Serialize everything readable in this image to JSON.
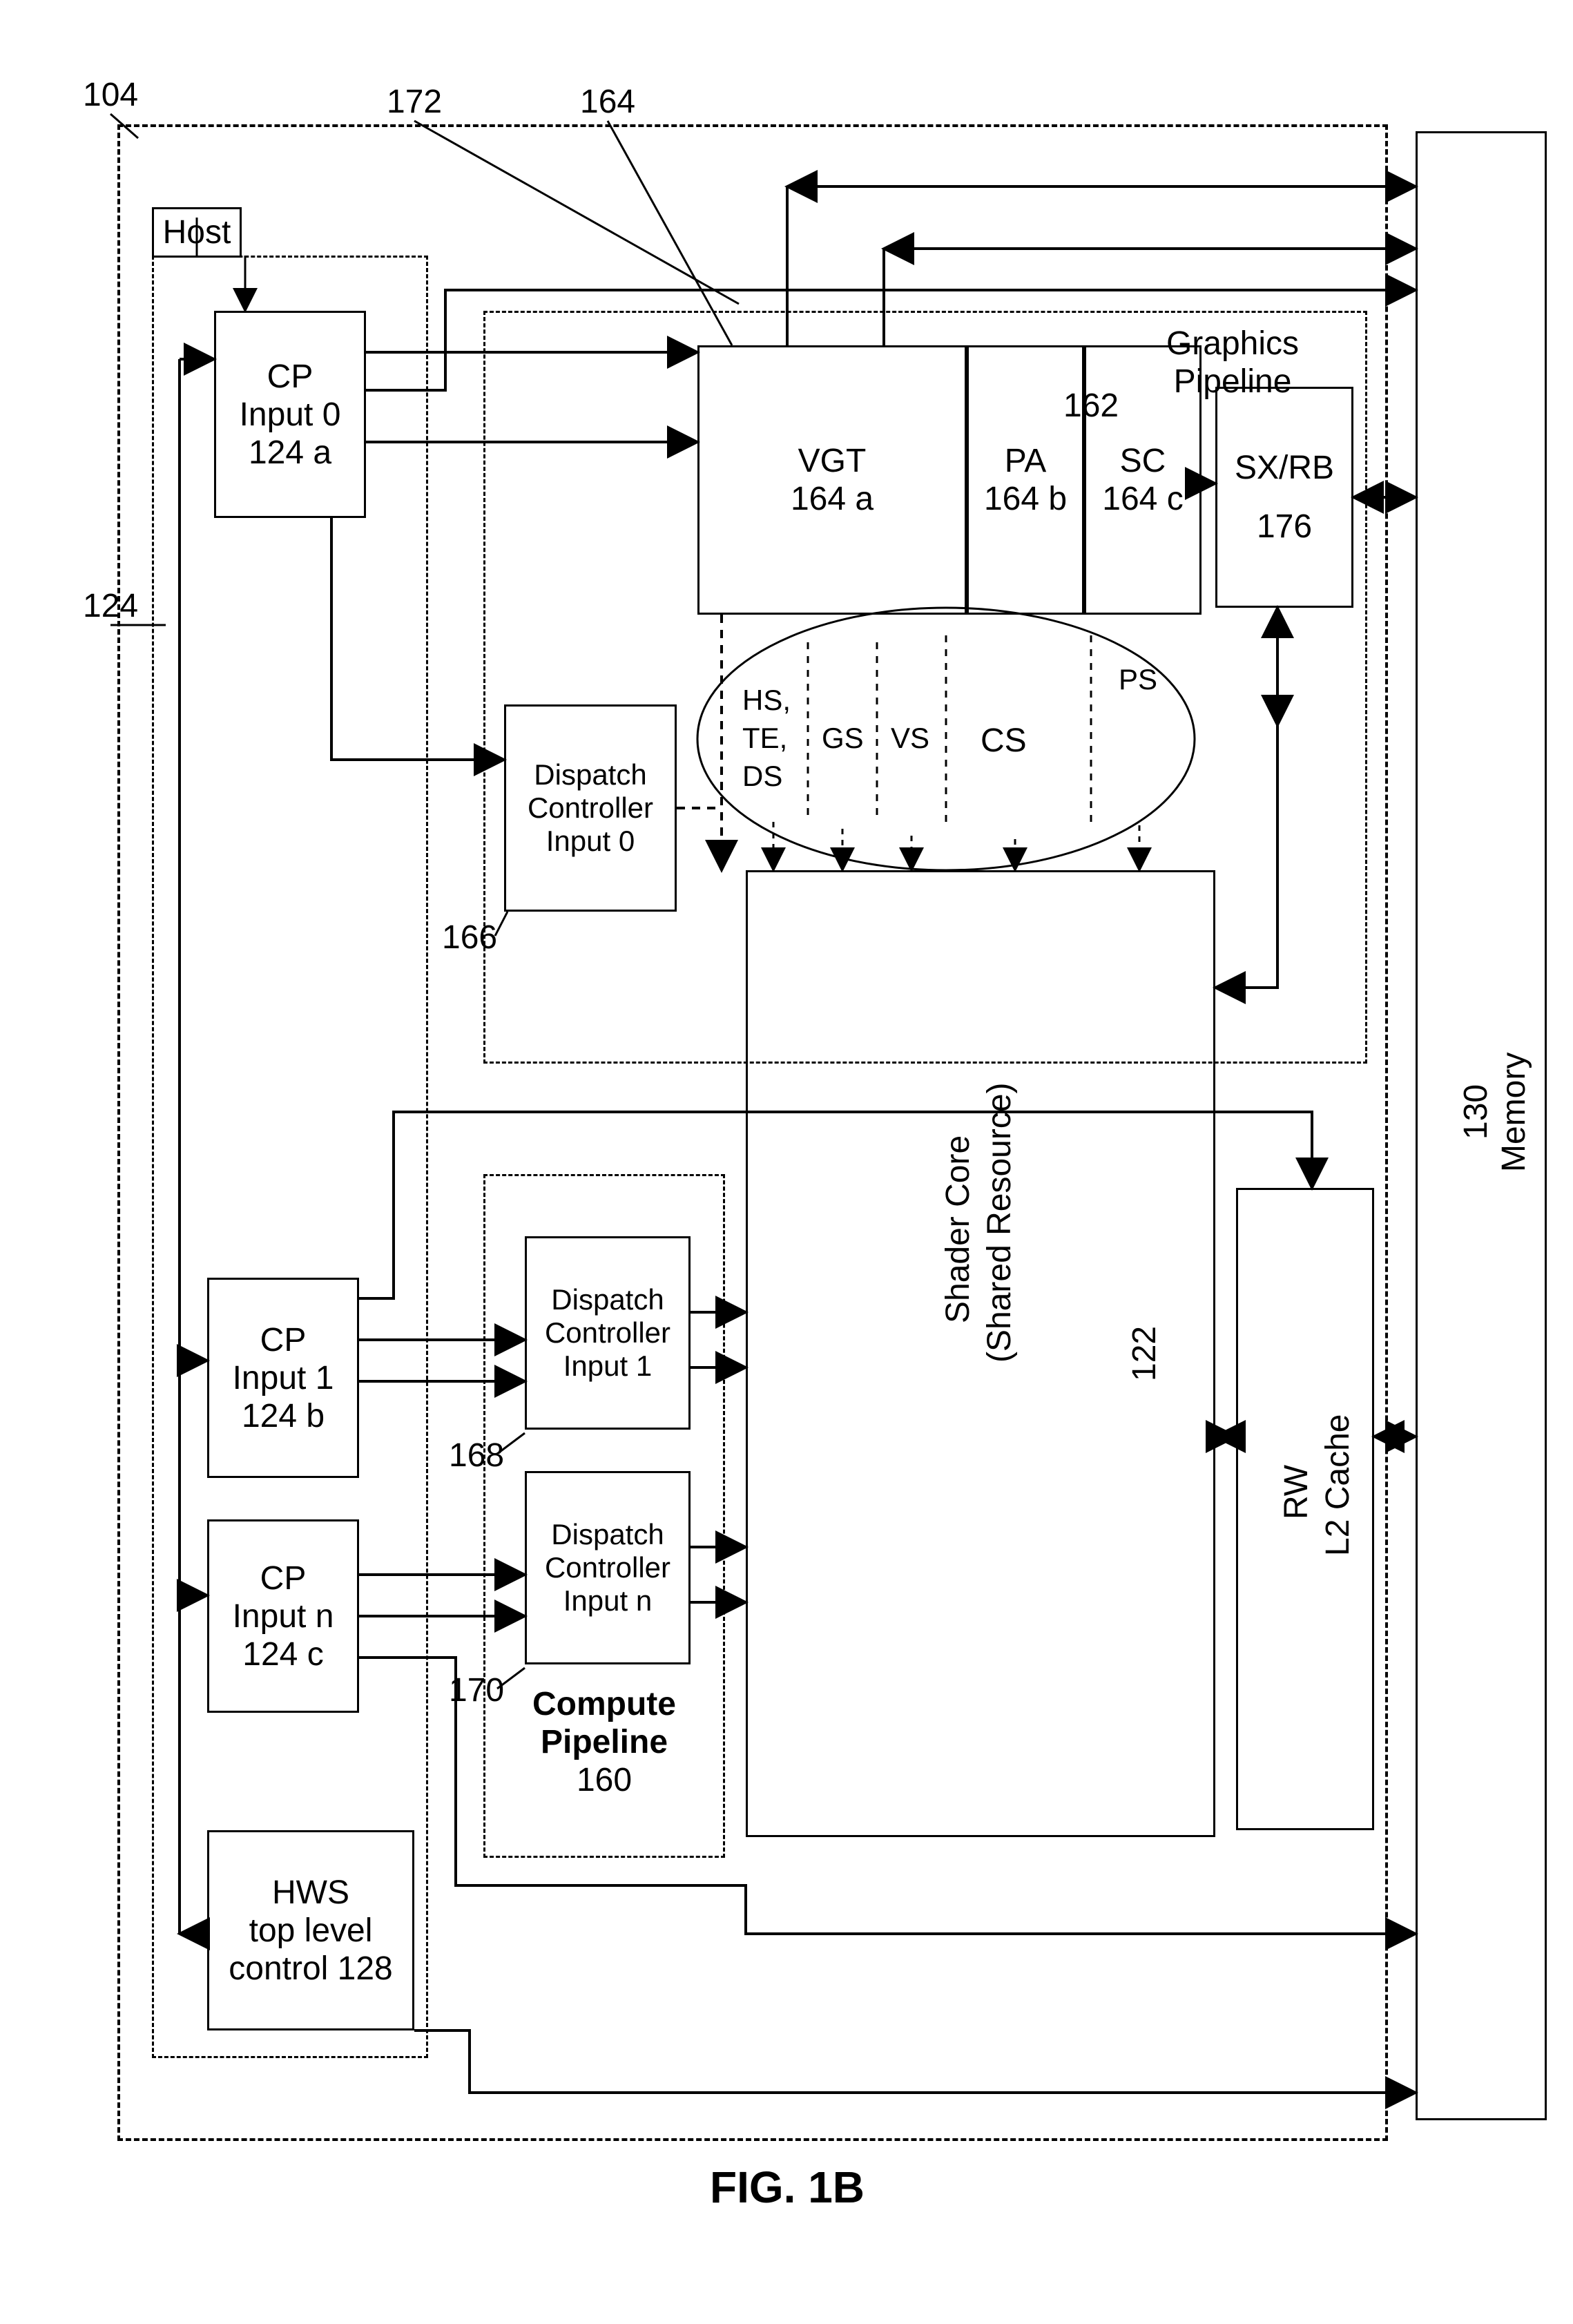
{
  "figure": "FIG. 1B",
  "refs": {
    "chip": "104",
    "cp_group": "124",
    "hws": "128",
    "memory": "130",
    "shader": "122",
    "compute_pipeline": "160",
    "graphics_pipeline": "162",
    "asm_group": "164",
    "vgt": "164 a",
    "pa": "164 b",
    "sc": "164 c",
    "dc0": "166",
    "dc1": "168",
    "dcn": "170",
    "arrow_vgt_mem": "172",
    "sxrb": "176"
  },
  "blocks": {
    "host": "Host",
    "cp0": {
      "l1": "CP",
      "l2": "Input 0",
      "ref": "124 a"
    },
    "cp1": {
      "l1": "CP",
      "l2": "Input 1",
      "ref": "124 b"
    },
    "cpn": {
      "l1": "CP",
      "l2": "Input n",
      "ref": "124 c"
    },
    "hws": {
      "l1": "HWS",
      "l2": "top level",
      "l3": "control 128"
    },
    "dc0": {
      "l1": "Dispatch",
      "l2": "Controller",
      "l3": "Input 0"
    },
    "dc1": {
      "l1": "Dispatch",
      "l2": "Controller",
      "l3": "Input 1"
    },
    "dcn": {
      "l1": "Dispatch",
      "l2": "Controller",
      "l3": "Input n"
    },
    "compute_pipeline": {
      "l1": "Compute",
      "l2": "Pipeline",
      "l3": "160"
    },
    "graphics_pipeline": "Graphics Pipeline",
    "vgt": "VGT",
    "pa": "PA",
    "sc": "SC",
    "sxrb": "SX/RB",
    "shader": {
      "l1": "Shader Core",
      "l2": "(Shared Resource)"
    },
    "l2cache": {
      "l1": "RW",
      "l2": "L2 Cache"
    },
    "memory": {
      "l1": "130",
      "l2": "Memory"
    }
  },
  "stages": {
    "hs": "HS,",
    "te": "TE,",
    "ds": "DS",
    "gs": "GS",
    "vs": "VS",
    "cs": "CS",
    "ps": "PS"
  }
}
